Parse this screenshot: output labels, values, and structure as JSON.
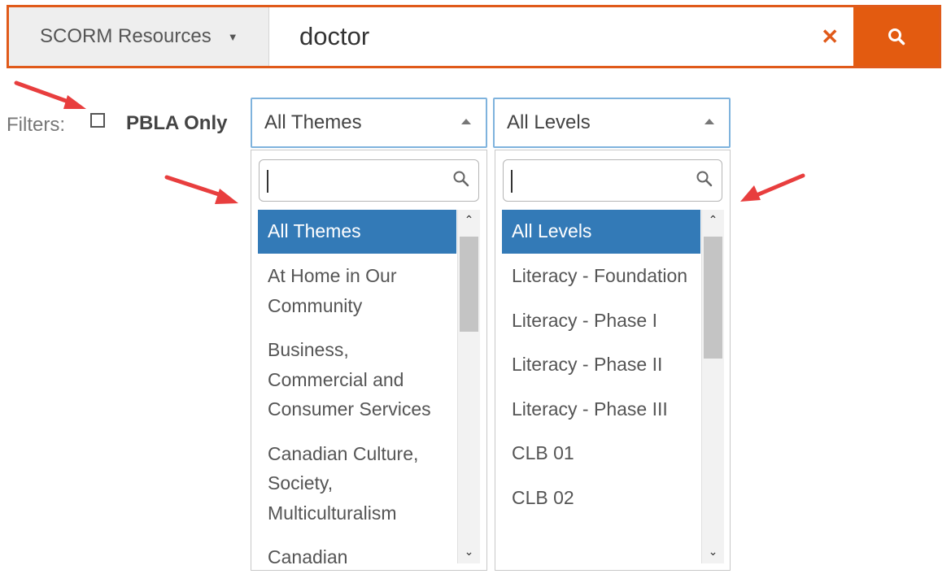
{
  "search": {
    "scope_label": "SCORM Resources",
    "query_value": "doctor",
    "colors": {
      "accent": "#e35b10"
    }
  },
  "filters": {
    "label": "Filters:",
    "pbla_label": "PBLA Only",
    "pbla_checked": false
  },
  "themes": {
    "selected": "All Themes",
    "search_value": "",
    "options": [
      "All Themes",
      "At Home in Our Community",
      "Business, Commercial and Consumer Services",
      "Canadian Culture, Society, Multiculturalism",
      "Canadian"
    ],
    "highlighted_index": 0
  },
  "levels": {
    "selected": "All Levels",
    "search_value": "",
    "options": [
      "All Levels",
      "Literacy - Foundation",
      "Literacy - Phase I",
      "Literacy - Phase II",
      "Literacy - Phase III",
      "CLB 01",
      "CLB 02"
    ],
    "highlighted_index": 0
  },
  "icons": {
    "scope_caret": "caret-down-icon",
    "clear": "close-icon",
    "search": "search-icon",
    "select_caret": "caret-up-icon",
    "annotation": "red-arrow-icon"
  }
}
